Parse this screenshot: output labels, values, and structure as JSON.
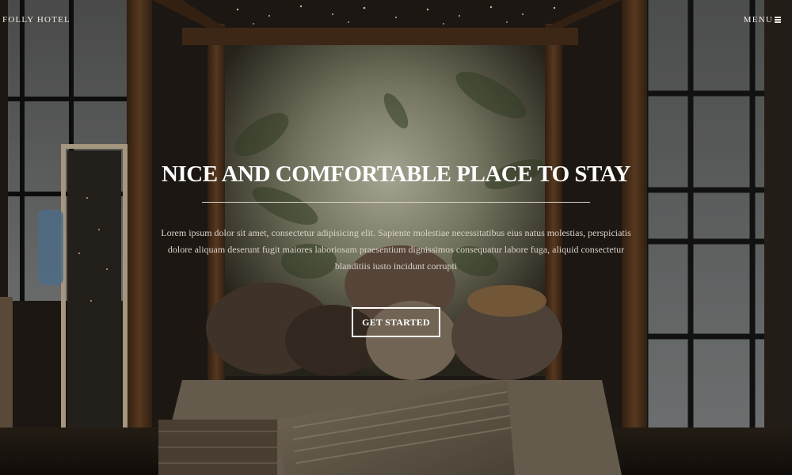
{
  "header": {
    "brand": "FOLLY HOTEL",
    "menu_label": "MENU",
    "menu_icon": "hamburger-icon"
  },
  "hero": {
    "title": "NICE AND COMFORTABLE PLACE TO STAY",
    "description": "Lorem ipsum dolor sit amet, consectetur adipisicing elit. Sapiente molestiae necessitatibus eius natus molestias, perspiciatis dolore aliquam deserunt fugit maiores laboriosam praesentium dignissimos consequatur labore fuga, aliquid consectetur blanditiis iusto incidunt corrupti",
    "cta_label": "GET STARTED"
  },
  "colors": {
    "text": "#ffffff",
    "overlay": "#000000",
    "wood_frame": "#5a3a22",
    "background_glow": "#c9c6b0"
  }
}
